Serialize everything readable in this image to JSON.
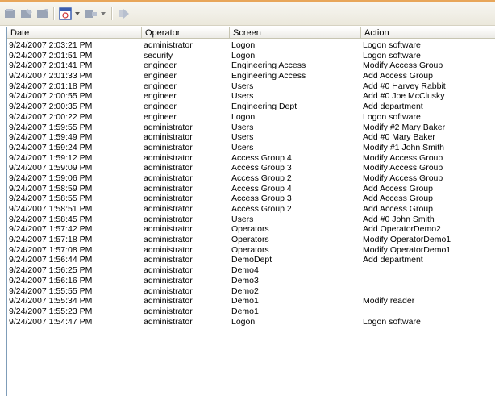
{
  "toolbar": {
    "buttons": [
      {
        "name": "open-icon",
        "glyph": "▪"
      },
      {
        "name": "edit-icon",
        "glyph": "▪"
      },
      {
        "name": "save-icon",
        "glyph": "▪"
      },
      {
        "name": "calendar-icon",
        "glyph": "▣"
      },
      {
        "name": "export-icon",
        "glyph": "▪"
      },
      {
        "name": "refresh-icon",
        "glyph": "✧"
      }
    ],
    "colors": {
      "icon_gray": "#9aa4b6",
      "calendar_blue": "#3a5db0",
      "accent": "#e8a65a"
    }
  },
  "table": {
    "columns": [
      "Date",
      "Operator",
      "Screen",
      "Action"
    ],
    "rows": [
      [
        "9/24/2007 2:03:21 PM",
        "administrator",
        "Logon",
        "Logon software"
      ],
      [
        "9/24/2007 2:01:51 PM",
        "security",
        "Logon",
        "Logon software"
      ],
      [
        "9/24/2007 2:01:41 PM",
        "engineer",
        "Engineering Access",
        "Modify Access Group"
      ],
      [
        "9/24/2007 2:01:33 PM",
        "engineer",
        "Engineering Access",
        "Add Access Group"
      ],
      [
        "9/24/2007 2:01:18 PM",
        "engineer",
        "Users",
        "Add #0 Harvey Rabbit"
      ],
      [
        "9/24/2007 2:00:55 PM",
        "engineer",
        "Users",
        "Add #0 Joe McClusky"
      ],
      [
        "9/24/2007 2:00:35 PM",
        "engineer",
        "Engineering Dept",
        "Add department"
      ],
      [
        "9/24/2007 2:00:22 PM",
        "engineer",
        "Logon",
        "Logon software"
      ],
      [
        "9/24/2007 1:59:55 PM",
        "administrator",
        "Users",
        "Modify #2 Mary Baker"
      ],
      [
        "9/24/2007 1:59:49 PM",
        "administrator",
        "Users",
        "Add #0 Mary Baker"
      ],
      [
        "9/24/2007 1:59:24 PM",
        "administrator",
        "Users",
        "Modify #1 John Smith"
      ],
      [
        "9/24/2007 1:59:12 PM",
        "administrator",
        "Access Group 4",
        "Modify Access Group"
      ],
      [
        "9/24/2007 1:59:09 PM",
        "administrator",
        "Access Group 3",
        "Modify Access Group"
      ],
      [
        "9/24/2007 1:59:06 PM",
        "administrator",
        "Access Group 2",
        "Modify Access Group"
      ],
      [
        "9/24/2007 1:58:59 PM",
        "administrator",
        "Access Group 4",
        "Add Access Group"
      ],
      [
        "9/24/2007 1:58:55 PM",
        "administrator",
        "Access Group 3",
        "Add Access Group"
      ],
      [
        "9/24/2007 1:58:51 PM",
        "administrator",
        "Access Group 2",
        "Add Access Group"
      ],
      [
        "9/24/2007 1:58:45 PM",
        "administrator",
        "Users",
        "Add #0 John Smith"
      ],
      [
        "9/24/2007 1:57:42 PM",
        "administrator",
        "Operators",
        "Add OperatorDemo2"
      ],
      [
        "9/24/2007 1:57:18 PM",
        "administrator",
        "Operators",
        "Modify OperatorDemo1"
      ],
      [
        "9/24/2007 1:57:08 PM",
        "administrator",
        "Operators",
        "Modify OperatorDemo1"
      ],
      [
        "9/24/2007 1:56:44 PM",
        "administrator",
        "DemoDept",
        "Add department"
      ],
      [
        "9/24/2007 1:56:25 PM",
        "administrator",
        "Demo4",
        ""
      ],
      [
        "9/24/2007 1:56:16 PM",
        "administrator",
        "Demo3",
        ""
      ],
      [
        "9/24/2007 1:55:55 PM",
        "administrator",
        "Demo2",
        ""
      ],
      [
        "9/24/2007 1:55:34 PM",
        "administrator",
        "Demo1",
        "Modify reader"
      ],
      [
        "9/24/2007 1:55:23 PM",
        "administrator",
        "Demo1",
        ""
      ],
      [
        "9/24/2007 1:54:47 PM",
        "administrator",
        "Logon",
        "Logon software"
      ]
    ]
  }
}
